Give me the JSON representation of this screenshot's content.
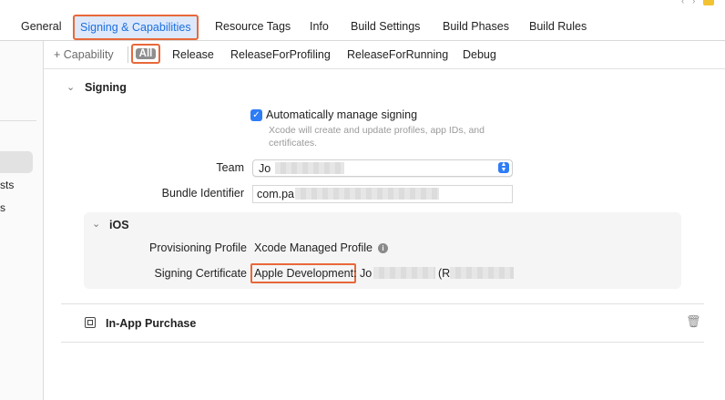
{
  "tabs": {
    "items": [
      "General",
      "Signing & Capabilities",
      "Resource Tags",
      "Info",
      "Build Settings",
      "Build Phases",
      "Build Rules"
    ],
    "selected_index": 1
  },
  "sidebar": {
    "partial_labels": [
      "sts",
      "s"
    ]
  },
  "filterbar": {
    "capability_label": "+ Capability",
    "configs": [
      "All",
      "Release",
      "ReleaseForProfiling",
      "ReleaseForRunning",
      "Debug"
    ],
    "selected": "All"
  },
  "signing": {
    "section_title": "Signing",
    "auto_manage_label": "Automatically manage signing",
    "auto_manage_checked": true,
    "auto_manage_hint_line1": "Xcode will create and update profiles, app IDs, and",
    "auto_manage_hint_line2": "certificates.",
    "team_label": "Team",
    "team_value": "Jo",
    "bundle_label": "Bundle Identifier",
    "bundle_value": "com.pa"
  },
  "ios": {
    "section_title": "iOS",
    "profile_label": "Provisioning Profile",
    "profile_value": "Xcode Managed Profile",
    "cert_label": "Signing Certificate",
    "cert_value_highlight": "Apple Development:",
    "cert_value_rest": "Jo",
    "cert_value_paren": "(R"
  },
  "iap": {
    "title": "In-App Purchase"
  },
  "colors": {
    "accent": "#2e7cf6",
    "highlight_border": "#e8683a",
    "selected_tab_text": "#1d6fe0",
    "selected_tab_bg": "#dde9fb"
  },
  "icons": [
    "warning-icon",
    "chevron-down-icon",
    "checkbox-checked-icon",
    "popup-stepper-icon",
    "info-icon",
    "in-app-purchase-icon",
    "trash-icon"
  ]
}
